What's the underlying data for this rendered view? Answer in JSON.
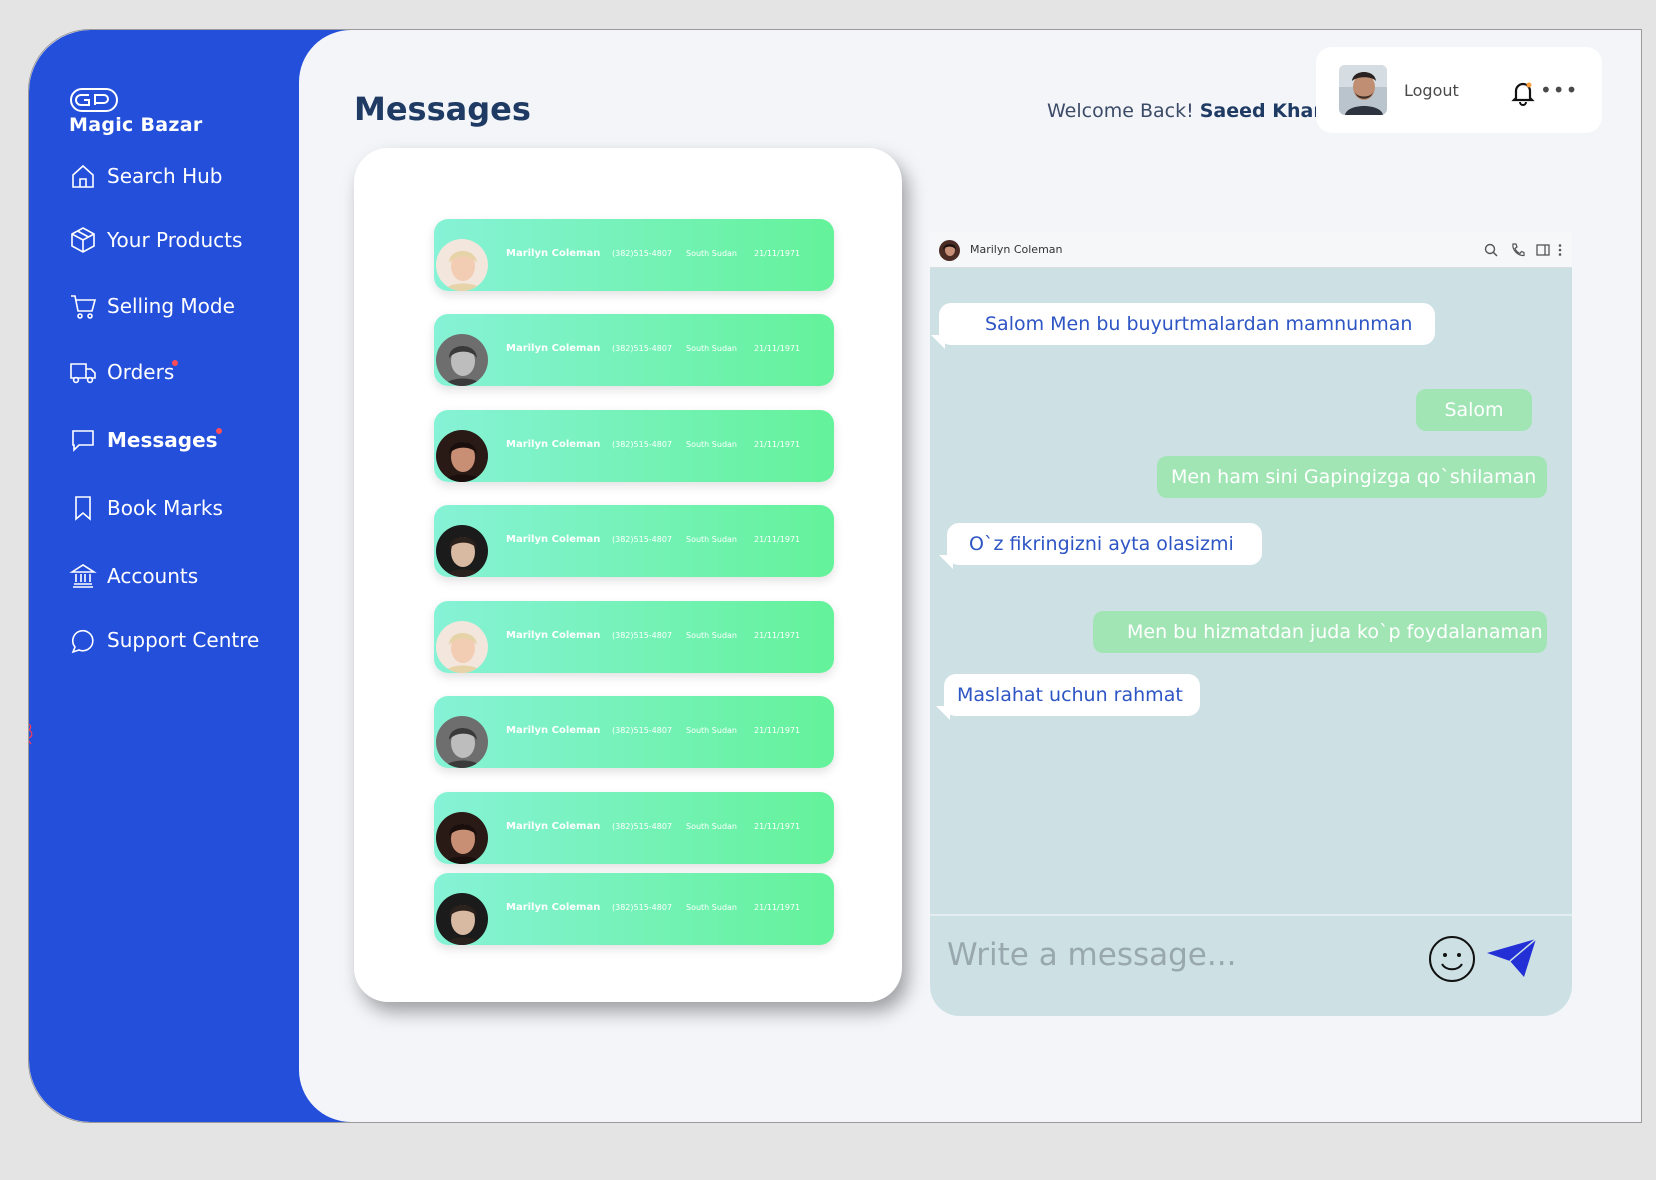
{
  "brand": {
    "name": "Magic Bazar"
  },
  "nav": [
    {
      "label": "Search Hub",
      "icon": "home-icon",
      "badge": false,
      "active": false
    },
    {
      "label": "Your Products",
      "icon": "box-icon",
      "badge": false,
      "active": false
    },
    {
      "label": "Selling Mode",
      "icon": "cart-icon",
      "badge": false,
      "active": false
    },
    {
      "label": "Orders",
      "icon": "truck-icon",
      "badge": true,
      "active": false
    },
    {
      "label": "Messages",
      "icon": "message-icon",
      "badge": true,
      "active": true
    },
    {
      "label": "Book Marks",
      "icon": "bookmark-icon",
      "badge": false,
      "active": false
    },
    {
      "label": "Accounts",
      "icon": "bank-icon",
      "badge": false,
      "active": false
    },
    {
      "label": "Support Centre",
      "icon": "chat-bubble-icon",
      "badge": false,
      "active": false
    }
  ],
  "header": {
    "title": "Messages",
    "welcome_prefix": "Welcome Back!",
    "user_name": "Saeed Khan",
    "logout_label": "Logout",
    "more_label": "•••"
  },
  "contacts": [
    {
      "name": "Marilyn Coleman",
      "phone": "(382)515-4807",
      "country": "South Sudan",
      "date": "21/11/1971"
    },
    {
      "name": "Marilyn Coleman",
      "phone": "(382)515-4807",
      "country": "South Sudan",
      "date": "21/11/1971"
    },
    {
      "name": "Marilyn Coleman",
      "phone": "(382)515-4807",
      "country": "South Sudan",
      "date": "21/11/1971"
    },
    {
      "name": "Marilyn Coleman",
      "phone": "(382)515-4807",
      "country": "South Sudan",
      "date": "21/11/1971"
    },
    {
      "name": "Marilyn Coleman",
      "phone": "(382)515-4807",
      "country": "South Sudan",
      "date": "21/11/1971"
    },
    {
      "name": "Marilyn Coleman",
      "phone": "(382)515-4807",
      "country": "South Sudan",
      "date": "21/11/1971"
    },
    {
      "name": "Marilyn Coleman",
      "phone": "(382)515-4807",
      "country": "South Sudan",
      "date": "21/11/1971"
    },
    {
      "name": "Marilyn Coleman",
      "phone": "(382)515-4807",
      "country": "South Sudan",
      "date": "21/11/1971"
    }
  ],
  "chat": {
    "contact_name": "Marilyn Coleman",
    "messages": [
      {
        "direction": "in",
        "text": "Salom Men bu buyurtmalardan mamnunman"
      },
      {
        "direction": "out",
        "text": "Salom"
      },
      {
        "direction": "out",
        "text": "Men ham sini Gapingizga qo`shilaman"
      },
      {
        "direction": "in",
        "text": "O`z fikringizni ayta olasizmi"
      },
      {
        "direction": "out",
        "text": "Men bu hizmatdan juda ko`p foydalanaman"
      },
      {
        "direction": "in",
        "text": "Maslahat uchun rahmat"
      }
    ],
    "composer_placeholder": "Write a message..."
  },
  "colors": {
    "sidebar": "#234fdb",
    "accent_green": "#64f29a",
    "incoming_text": "#2d55c4",
    "outgoing_bubble": "#a1e5b5",
    "send_icon": "#2230d6"
  }
}
